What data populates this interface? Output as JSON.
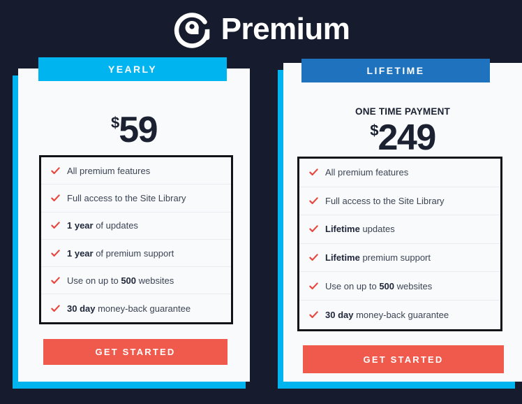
{
  "header": {
    "logo_icon": "premium-circle-logo-icon",
    "title": "Premium"
  },
  "colors": {
    "background": "#161c2d",
    "card_background": "#f8fafc",
    "yearly_accent": "#00b5ef",
    "lifetime_accent": "#1f72bd",
    "cta": "#ef5a4c",
    "check": "#e8453c",
    "text_dark": "#20273a",
    "text_body": "#3c4454"
  },
  "plans": [
    {
      "id": "yearly",
      "badge": "YEARLY",
      "subtitle": "",
      "currency": "$",
      "amount": "59",
      "cta_label": "GET STARTED",
      "features": [
        {
          "bold": "",
          "text": "All premium features"
        },
        {
          "bold": "",
          "text": "Full access to the Site Library"
        },
        {
          "bold": "1 year",
          "text": " of updates"
        },
        {
          "bold": "1 year",
          "text": " of premium support"
        },
        {
          "pre": "Use on up to ",
          "bold": "500",
          "text": " websites"
        },
        {
          "bold": "30 day",
          "text": " money-back guarantee"
        }
      ]
    },
    {
      "id": "lifetime",
      "badge": "LIFETIME",
      "subtitle": "ONE TIME PAYMENT",
      "currency": "$",
      "amount": "249",
      "cta_label": "GET STARTED",
      "features": [
        {
          "bold": "",
          "text": "All premium features"
        },
        {
          "bold": "",
          "text": "Full access to the Site Library"
        },
        {
          "bold": "Lifetime",
          "text": " updates"
        },
        {
          "bold": "Lifetime",
          "text": " premium support"
        },
        {
          "pre": "Use on up to ",
          "bold": "500",
          "text": " websites"
        },
        {
          "bold": "30 day",
          "text": " money-back guarantee"
        }
      ]
    }
  ]
}
